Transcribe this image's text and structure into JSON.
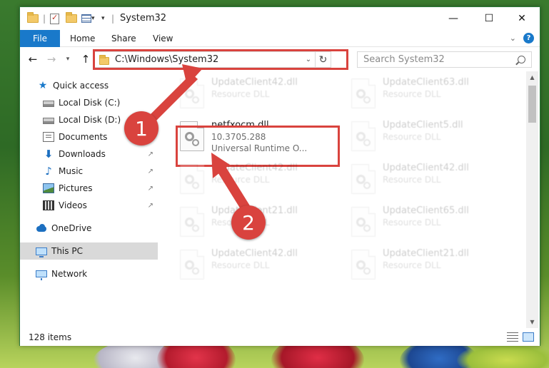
{
  "window": {
    "title": "System32",
    "minimize_glyph": "—",
    "maximize_glyph": "☐",
    "close_glyph": "✕"
  },
  "ribbon": {
    "tabs": [
      "File",
      "Home",
      "Share",
      "View"
    ],
    "help_glyph": "?"
  },
  "address_bar": {
    "path": "C:\\Windows\\System32",
    "search_placeholder": "Search System32"
  },
  "navigation": {
    "items": [
      {
        "label": "Quick access",
        "icon": "star-icon"
      },
      {
        "label": "Local Disk (C:)",
        "icon": "drive-icon"
      },
      {
        "label": "Local Disk (D:)",
        "icon": "drive-icon"
      },
      {
        "label": "Documents",
        "icon": "documents-icon",
        "pinned": true
      },
      {
        "label": "Downloads",
        "icon": "downloads-icon",
        "pinned": true
      },
      {
        "label": "Music",
        "icon": "music-icon",
        "pinned": true
      },
      {
        "label": "Pictures",
        "icon": "pictures-icon",
        "pinned": true
      },
      {
        "label": "Videos",
        "icon": "videos-icon",
        "pinned": true
      },
      {
        "label": "OneDrive",
        "icon": "onedrive-icon"
      },
      {
        "label": "This PC",
        "icon": "this-pc-icon",
        "selected": true
      },
      {
        "label": "Network",
        "icon": "network-icon"
      }
    ],
    "pin_glyph": "↗"
  },
  "files": {
    "highlighted": {
      "name": "netfxocm.dll",
      "version": "10.3705.288",
      "description": "Universal Runtime O..."
    },
    "background": [
      {
        "name": "UpdateClient42.dll",
        "type": "Resource DLL"
      },
      {
        "name": "UpdateClient63.dll",
        "type": "Resource DLL"
      },
      {
        "name": "UpdateClient5.dll",
        "type": "Resource DLL"
      },
      {
        "name": "UpdateClient42.dll",
        "type": "Resource DLL"
      },
      {
        "name": "UpdateClient42.dll",
        "type": "Resource DLL"
      },
      {
        "name": "UpdateClient21.dll",
        "type": "Resource DLL"
      },
      {
        "name": "UpdateClient65.dll",
        "type": "Resource DLL"
      },
      {
        "name": "UpdateClient42.dll",
        "type": "Resource DLL"
      },
      {
        "name": "UpdateClient21.dll",
        "type": "Resource DLL"
      }
    ]
  },
  "status_bar": {
    "item_count": "128 items"
  },
  "callouts": {
    "step1": "1",
    "step2": "2",
    "color": "#d9433e"
  },
  "colors": {
    "accent": "#1979ca",
    "highlight": "#d9433e"
  }
}
